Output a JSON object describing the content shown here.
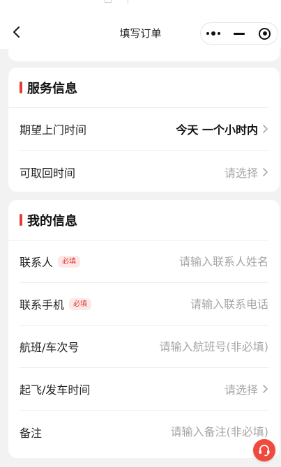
{
  "nav": {
    "title": "填写订单",
    "back_icon": "chevron-left-icon",
    "capsule_icons": [
      "more-dots-icon",
      "minimize-icon",
      "target-close-icon"
    ]
  },
  "service_info": {
    "title": "服务信息",
    "rows": [
      {
        "label": "期望上门时间",
        "value": "今天 一个小时内",
        "placeholder": "",
        "icon": "chevron-right-icon"
      },
      {
        "label": "可取回时间",
        "value": "",
        "placeholder": "请选择",
        "icon": "chevron-right-icon"
      }
    ]
  },
  "my_info": {
    "title": "我的信息",
    "rows": [
      {
        "label": "联系人",
        "badge": "必填",
        "placeholder": "请输入联系人姓名"
      },
      {
        "label": "联系手机",
        "badge": "必填",
        "placeholder": "请输入联系电话"
      },
      {
        "label": "航班/车次号",
        "placeholder": "请输入航班号(非必填)"
      },
      {
        "label": "起飞/发车时间",
        "placeholder": "请选择",
        "icon": "chevron-right-icon"
      },
      {
        "label": "备注",
        "placeholder": "请输入备注(非必填)"
      }
    ]
  },
  "customer_service_icon": "headset-icon",
  "colors": {
    "accent": "#e53935",
    "badge_bg": "#fde8e8",
    "placeholder": "#a6a6a6",
    "page_bg": "#f2f2f2"
  }
}
